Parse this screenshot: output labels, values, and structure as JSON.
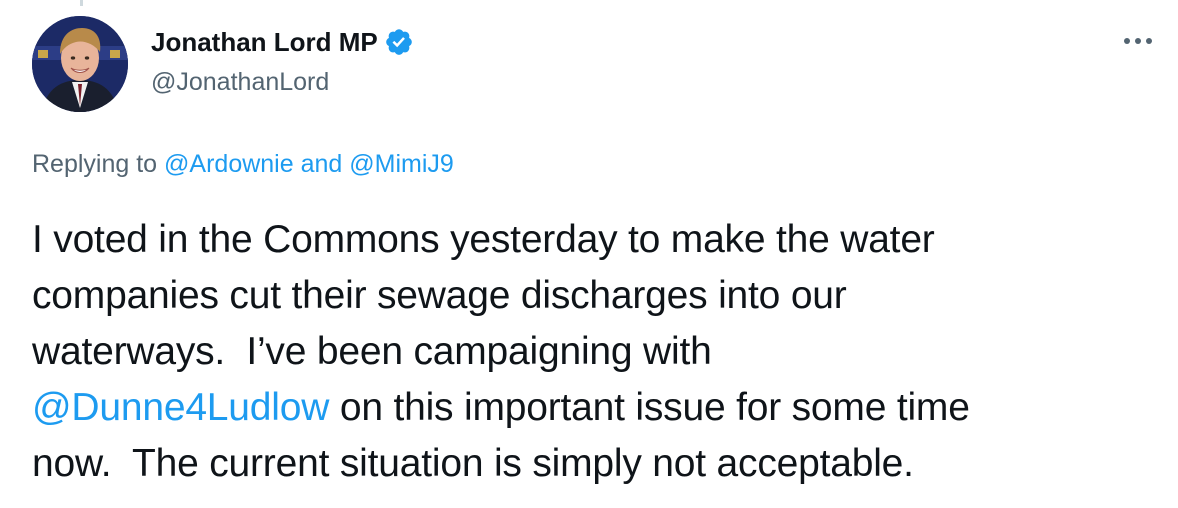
{
  "tweet": {
    "author": {
      "display_name": "Jonathan Lord MP",
      "handle": "@JonathanLord",
      "verified": true
    },
    "reply_context": {
      "prefix": "Replying to ",
      "mention_1": "@Ardownie",
      "joiner": " and ",
      "mention_2": "@MimiJ9"
    },
    "body": {
      "line_1": "I voted in the Commons yesterday to make the water",
      "line_2": "companies cut their sewage discharges into our",
      "line_3": "waterways.  I’ve been campaigning with",
      "line_4_mention": "@Dunne4Ludlow",
      "line_4_rest": " on this important issue for some time",
      "line_5": "now.  The current situation is simply not acceptable."
    },
    "icons": {
      "verified": "verified-badge-icon",
      "more": "more-options-icon"
    },
    "colors": {
      "link": "#1d9bf0",
      "secondary": "#536471",
      "text": "#0f1419"
    }
  }
}
